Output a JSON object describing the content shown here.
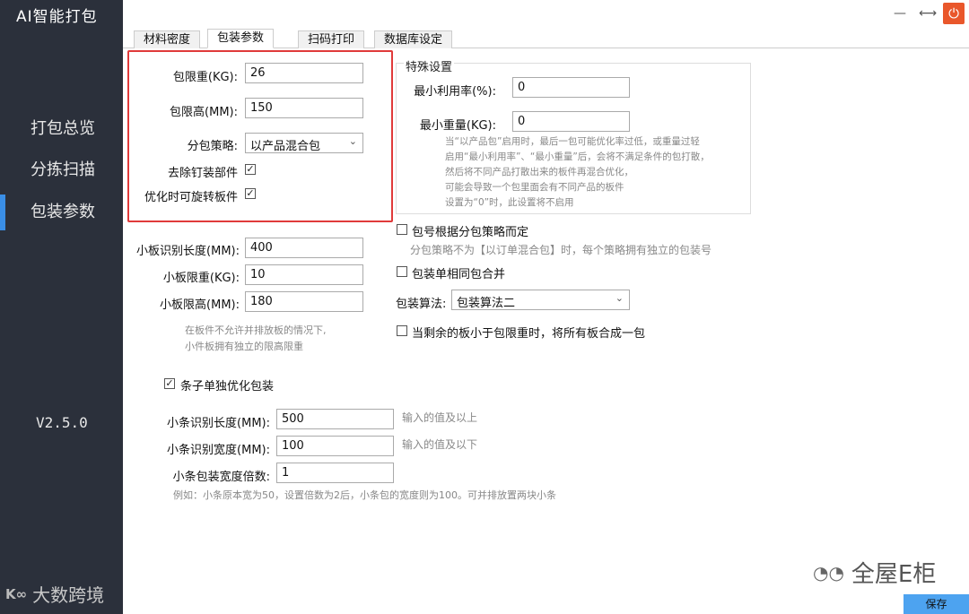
{
  "app": {
    "title": "AI智能打包",
    "version": "V2.5.0",
    "watermark_left": "大数跨境",
    "watermark_right": "全屋E柜"
  },
  "sidebar": {
    "items": [
      {
        "label": "打包总览",
        "active": false
      },
      {
        "label": "分拣扫描",
        "active": false
      },
      {
        "label": "包装参数",
        "active": true
      }
    ]
  },
  "window": {
    "minimize_icon": "—",
    "restore_icon": "⟷",
    "power_icon": "⏻"
  },
  "tabs": [
    {
      "label": "材料密度",
      "active": false
    },
    {
      "label": "包装参数",
      "active": true
    },
    {
      "label": "扫码打印",
      "active": false
    },
    {
      "label": "数据库设定",
      "active": false
    }
  ],
  "form": {
    "max_weight": {
      "label": "包限重(KG):",
      "value": "26"
    },
    "max_height": {
      "label": "包限高(MM):",
      "value": "150"
    },
    "strategy": {
      "label": "分包策略:",
      "value": "以产品混合包"
    },
    "remove_nail": {
      "label": "去除钉装部件",
      "checked": true
    },
    "rotate_board": {
      "label": "优化时可旋转板件",
      "checked": true
    },
    "small_len": {
      "label": "小板识别长度(MM):",
      "value": "400"
    },
    "small_weight": {
      "label": "小板限重(KG):",
      "value": "10"
    },
    "small_height": {
      "label": "小板限高(MM):",
      "value": "180"
    },
    "small_hint": [
      "在板件不允许并排放板的情况下,",
      "小件板拥有独立的限高限重"
    ],
    "strip_opt": {
      "label": "条子单独优化包装",
      "checked": true
    },
    "strip_len": {
      "label": "小条识别长度(MM):",
      "value": "500",
      "hint": "输入的值及以上"
    },
    "strip_width": {
      "label": "小条识别宽度(MM):",
      "value": "100",
      "hint": "输入的值及以下"
    },
    "strip_multi": {
      "label": "小条包装宽度倍数:",
      "value": "1"
    },
    "strip_example": "例如：小条原本宽为50，设置倍数为2后，小条包的宽度则为100。可并排放置两块小条"
  },
  "special": {
    "title": "特殊设置",
    "min_util": {
      "label": "最小利用率(%):",
      "value": "0"
    },
    "min_weight": {
      "label": "最小重量(KG):",
      "value": "0"
    },
    "hint": [
      "当“以产品包”启用时，最后一包可能优化率过低，或重量过轻",
      "启用“最小利用率”、“最小重量”后，会将不满足条件的包打散，",
      "然后将不同产品打散出来的板件再混合优化，",
      "可能会导致一个包里面会有不同产品的板件",
      "设置为“0”时，此设置将不启用"
    ]
  },
  "right": {
    "pkg_no": {
      "label": "包号根据分包策略而定",
      "checked": false,
      "hint": "分包策略不为【以订单混合包】时，每个策略拥有独立的包装号"
    },
    "merge_same": {
      "label": "包装单相同包合并",
      "checked": false
    },
    "algorithm": {
      "label": "包装算法:",
      "value": "包装算法二"
    },
    "merge_small": {
      "label": "当剩余的板小于包限重时，将所有板合成一包",
      "checked": false
    }
  },
  "save_label": "保存"
}
